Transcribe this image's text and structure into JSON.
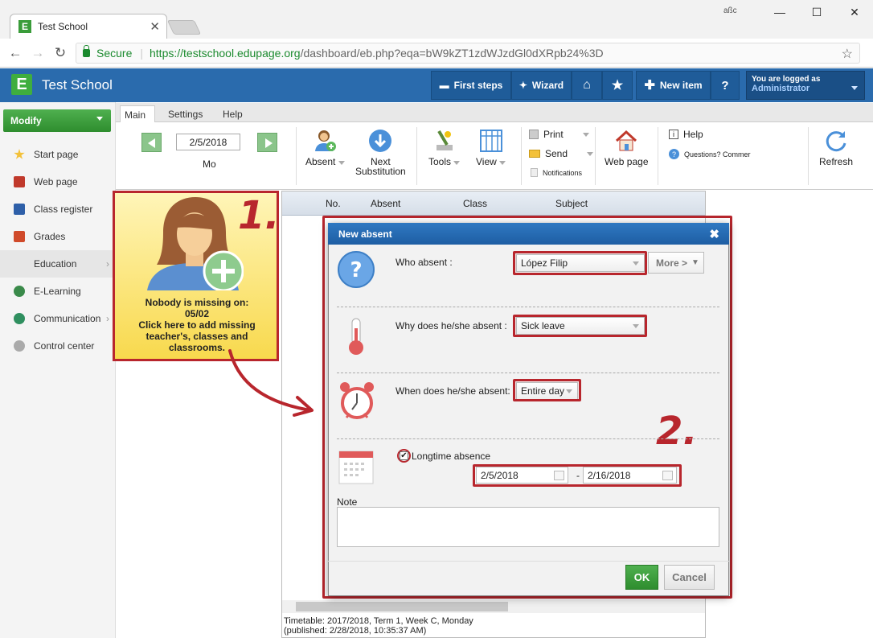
{
  "browser": {
    "tab_title": "Test School",
    "address_secure": "Secure",
    "url_host": "https://testschool.edupage.org",
    "url_path": "/dashboard/eb.php?eqa=bW9kZT1zdWJzdGl0dXRpb24%3D"
  },
  "header": {
    "title": "Test School",
    "buttons": [
      "First steps",
      "Wizard",
      "New item",
      "?"
    ],
    "logged_label": "You are logged as",
    "logged_user": "Administrator"
  },
  "sidebar": {
    "modify": "Modify",
    "items": [
      "Start page",
      "Web page",
      "Class register",
      "Grades",
      "Education",
      "E-Learning",
      "Communication",
      "Control center"
    ]
  },
  "ribbon": {
    "tabs": [
      "Main",
      "Settings",
      "Help"
    ],
    "date": "2/5/2018",
    "day": "Mo",
    "absent": "Absent",
    "next_sub_1": "Next",
    "next_sub_2": "Substitution",
    "tools": "Tools",
    "view": "View",
    "print": "Print",
    "send": "Send",
    "notifications": "Notifications",
    "web_page": "Web page",
    "help": "Help",
    "questions": "Questions? Commer",
    "refresh": "Refresh"
  },
  "tile": {
    "line1": "Nobody is missing on:",
    "line2": "05/02",
    "line3": "Click here to add missing",
    "line4": "teacher's, classes and",
    "line5": "classrooms.",
    "step": "1."
  },
  "grid": {
    "columns": [
      "No.",
      "Absent",
      "Class",
      "Subject"
    ],
    "footer1": "Timetable: 2017/2018, Term 1, Week C, Monday",
    "footer2": "(published: 2/28/2018, 10:35:37 AM)"
  },
  "dialog": {
    "title": "New absent",
    "who_label": "Who absent :",
    "who_value": "López Filip",
    "more": "More >",
    "why_label": "Why does he/she absent :",
    "why_value": "Sick leave",
    "when_label": "When does he/she absent:",
    "when_value": "Entire day",
    "longtime": "Longtime absence",
    "date_from": "2/5/2018",
    "date_sep": "-",
    "date_to": "2/16/2018",
    "note_label": "Note",
    "ok": "OK",
    "cancel": "Cancel",
    "step": "2."
  },
  "colors": {
    "accent_blue": "#2a6bad",
    "green": "#3fae3f",
    "annotation_red": "#b8262d"
  }
}
